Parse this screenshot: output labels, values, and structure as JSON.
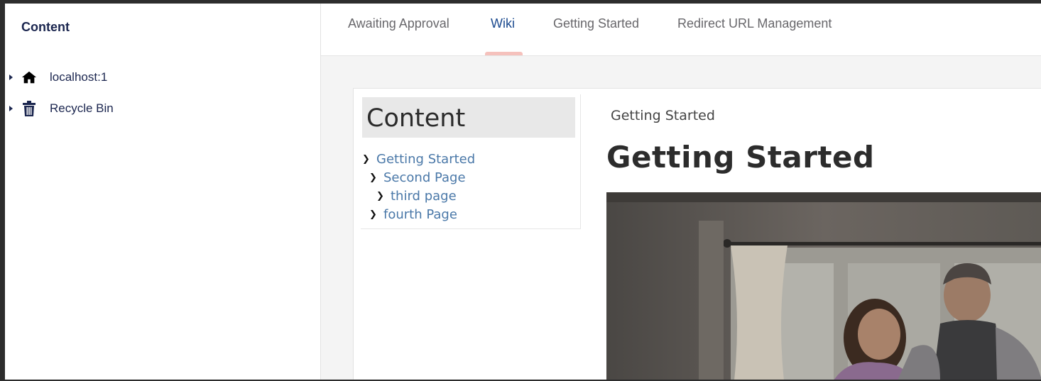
{
  "tree": {
    "header": "Content",
    "items": [
      {
        "label": "localhost:1",
        "icon": "home-icon"
      },
      {
        "label": "Recycle Bin",
        "icon": "trash-icon"
      }
    ]
  },
  "tabs": [
    {
      "label": "Awaiting Approval",
      "active": false
    },
    {
      "label": "Wiki",
      "active": true
    },
    {
      "label": "Getting Started",
      "active": false
    },
    {
      "label": "Redirect URL Management",
      "active": false
    }
  ],
  "wiki": {
    "toc_title": "Content",
    "toc_items": [
      {
        "label": "Getting Started"
      },
      {
        "label": "Second Page"
      },
      {
        "label": "third page"
      },
      {
        "label": "fourth Page"
      }
    ],
    "breadcrumb": "Getting Started",
    "heading": "Getting Started"
  },
  "colors": {
    "tree_text": "#1b264f",
    "tab_active": "#1b4a8f",
    "tab_indicator": "#f5c1bc",
    "toc_link": "#4a78a8"
  }
}
